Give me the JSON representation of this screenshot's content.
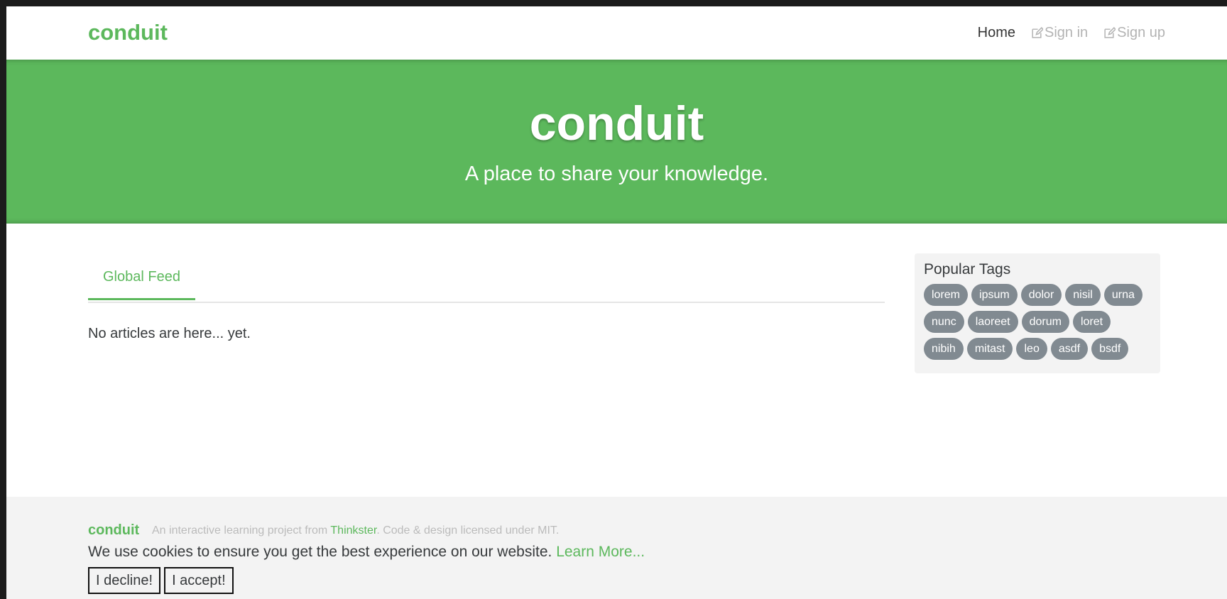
{
  "navbar": {
    "brand": "conduit",
    "links": {
      "home": "Home",
      "sign_in": "Sign in",
      "sign_up": "Sign up"
    }
  },
  "banner": {
    "title": "conduit",
    "subtitle": "A place to share your knowledge."
  },
  "feed": {
    "tab_global": "Global Feed",
    "empty_message": "No articles are here... yet."
  },
  "sidebar": {
    "title": "Popular Tags",
    "tags": [
      "lorem",
      "ipsum",
      "dolor",
      "nisil",
      "urna",
      "nunc",
      "laoreet",
      "dorum",
      "loret",
      "nibih",
      "mitast",
      "leo",
      "asdf",
      "bsdf"
    ]
  },
  "footer": {
    "brand": "conduit",
    "attribution_prefix": "An interactive learning project from ",
    "attribution_link": "Thinkster",
    "attribution_suffix": ". Code & design licensed under MIT."
  },
  "cookie_notice": {
    "text": "We use cookies to ensure you get the best experience on our website. ",
    "learn_more": "Learn More...",
    "decline": "I decline!",
    "accept": "I accept!"
  },
  "colors": {
    "brand_green": "#5cb85c",
    "tag_gray": "#818a91",
    "footer_bg": "#f3f3f3"
  },
  "icons": {
    "sign_in": "edit-icon",
    "sign_up": "edit-icon"
  }
}
